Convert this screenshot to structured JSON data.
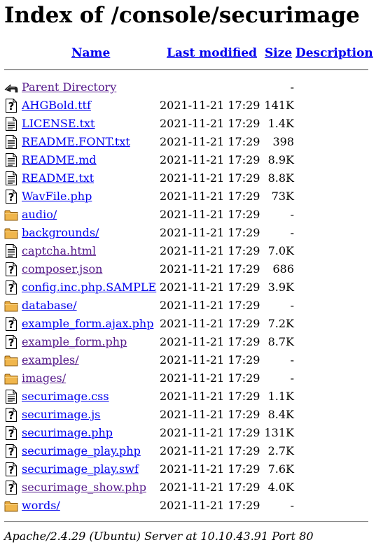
{
  "page": {
    "title": "Index of /console/securimage",
    "footer": "Apache/2.4.29 (Ubuntu) Server at 10.10.43.91 Port 80"
  },
  "columns": {
    "name": "Name",
    "last_modified": "Last modified",
    "size": "Size",
    "description": "Description"
  },
  "colors": {
    "link": "#0000EE",
    "visited": "#551A8B"
  },
  "rows": [
    {
      "name": "Parent Directory",
      "date": "",
      "size": "-",
      "icon": "back-icon",
      "visited": true
    },
    {
      "name": "AHGBold.ttf",
      "date": "2021-11-21 17:29",
      "size": "141K",
      "icon": "unknown-file-icon",
      "visited": false
    },
    {
      "name": "LICENSE.txt",
      "date": "2021-11-21 17:29",
      "size": "1.4K",
      "icon": "text-file-icon",
      "visited": false
    },
    {
      "name": "README.FONT.txt",
      "date": "2021-11-21 17:29",
      "size": "398",
      "icon": "text-file-icon",
      "visited": false
    },
    {
      "name": "README.md",
      "date": "2021-11-21 17:29",
      "size": "8.9K",
      "icon": "text-file-icon",
      "visited": false
    },
    {
      "name": "README.txt",
      "date": "2021-11-21 17:29",
      "size": "8.8K",
      "icon": "text-file-icon",
      "visited": false
    },
    {
      "name": "WavFile.php",
      "date": "2021-11-21 17:29",
      "size": "73K",
      "icon": "unknown-file-icon",
      "visited": false
    },
    {
      "name": "audio/",
      "date": "2021-11-21 17:29",
      "size": "-",
      "icon": "folder-icon",
      "visited": false
    },
    {
      "name": "backgrounds/",
      "date": "2021-11-21 17:29",
      "size": "-",
      "icon": "folder-icon",
      "visited": false
    },
    {
      "name": "captcha.html",
      "date": "2021-11-21 17:29",
      "size": "7.0K",
      "icon": "text-file-icon",
      "visited": true
    },
    {
      "name": "composer.json",
      "date": "2021-11-21 17:29",
      "size": "686",
      "icon": "unknown-file-icon",
      "visited": true
    },
    {
      "name": "config.inc.php.SAMPLE",
      "date": "2021-11-21 17:29",
      "size": "3.9K",
      "icon": "unknown-file-icon",
      "visited": false
    },
    {
      "name": "database/",
      "date": "2021-11-21 17:29",
      "size": "-",
      "icon": "folder-icon",
      "visited": false
    },
    {
      "name": "example_form.ajax.php",
      "date": "2021-11-21 17:29",
      "size": "7.2K",
      "icon": "unknown-file-icon",
      "visited": false
    },
    {
      "name": "example_form.php",
      "date": "2021-11-21 17:29",
      "size": "8.7K",
      "icon": "unknown-file-icon",
      "visited": true
    },
    {
      "name": "examples/",
      "date": "2021-11-21 17:29",
      "size": "-",
      "icon": "folder-icon",
      "visited": true
    },
    {
      "name": "images/",
      "date": "2021-11-21 17:29",
      "size": "-",
      "icon": "folder-icon",
      "visited": true
    },
    {
      "name": "securimage.css",
      "date": "2021-11-21 17:29",
      "size": "1.1K",
      "icon": "text-file-icon",
      "visited": false
    },
    {
      "name": "securimage.js",
      "date": "2021-11-21 17:29",
      "size": "8.4K",
      "icon": "unknown-file-icon",
      "visited": false
    },
    {
      "name": "securimage.php",
      "date": "2021-11-21 17:29",
      "size": "131K",
      "icon": "unknown-file-icon",
      "visited": false
    },
    {
      "name": "securimage_play.php",
      "date": "2021-11-21 17:29",
      "size": "2.7K",
      "icon": "unknown-file-icon",
      "visited": false
    },
    {
      "name": "securimage_play.swf",
      "date": "2021-11-21 17:29",
      "size": "7.6K",
      "icon": "unknown-file-icon",
      "visited": false
    },
    {
      "name": "securimage_show.php",
      "date": "2021-11-21 17:29",
      "size": "4.0K",
      "icon": "unknown-file-icon",
      "visited": true
    },
    {
      "name": "words/",
      "date": "2021-11-21 17:29",
      "size": "-",
      "icon": "folder-icon",
      "visited": false
    }
  ]
}
